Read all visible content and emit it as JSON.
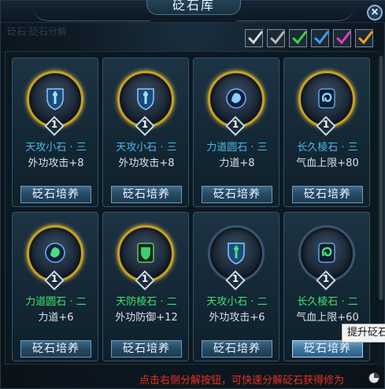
{
  "window": {
    "title": "砭石库",
    "subtitle": "砭石·砭石分解",
    "close_label": "×"
  },
  "filters": [
    {
      "name": "white",
      "color": "#d8d8d8"
    },
    {
      "name": "gray",
      "color": "#b8b8b8"
    },
    {
      "name": "green",
      "color": "#40d040"
    },
    {
      "name": "blue",
      "color": "#40a0f0"
    },
    {
      "name": "purple",
      "color": "#e040c0"
    },
    {
      "name": "orange",
      "color": "#f0a020"
    }
  ],
  "cards": [
    {
      "name": "天攻小石 · 三",
      "stat": "外功攻击+8",
      "level": "1",
      "button": "砭石培养",
      "ring": "gold",
      "name_color": "blue",
      "icon": "sword-shield-icon"
    },
    {
      "name": "天攻小石 · 三",
      "stat": "外功攻击+8",
      "level": "1",
      "button": "砭石培养",
      "ring": "gold",
      "name_color": "blue",
      "icon": "sword-shield-icon"
    },
    {
      "name": "力道圆石 · 三",
      "stat": "力道+8",
      "level": "1",
      "button": "砭石培养",
      "ring": "gold",
      "name_color": "blue",
      "icon": "fist-orb-icon"
    },
    {
      "name": "长久棱石 · 三",
      "stat": "气血上限+80",
      "level": "1",
      "button": "砭石培养",
      "ring": "gold",
      "name_color": "blue",
      "icon": "swirl-gem-icon"
    },
    {
      "name": "力道圆石 · 二",
      "stat": "力道+6",
      "level": "1",
      "button": "砭石培养",
      "ring": "gold",
      "name_color": "green",
      "icon": "fist-orb-icon"
    },
    {
      "name": "天防棱石 · 二",
      "stat": "外功防御+12",
      "level": "1",
      "button": "砭石培养",
      "ring": "gold",
      "name_color": "green",
      "icon": "shield-gem-icon"
    },
    {
      "name": "天攻小石 · 二",
      "stat": "外功攻击+6",
      "level": "1",
      "button": "砭石培养",
      "ring": "blue",
      "name_color": "green",
      "icon": "sword-shield-icon"
    },
    {
      "name": "长久棱石 · 二",
      "stat": "气血上限+60",
      "level": "1",
      "button": "砭石培养",
      "ring": "blue",
      "name_color": "green",
      "icon": "swirl-gem-icon"
    }
  ],
  "tooltip": "提升砭石",
  "hint": "点击右侧分解按钮，可快速分解砭石获得修为"
}
